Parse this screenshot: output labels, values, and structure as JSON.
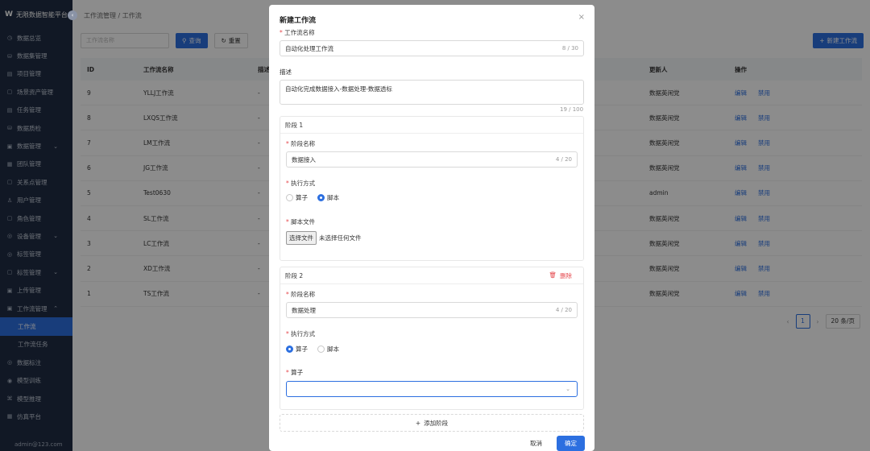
{
  "brand": {
    "logo": "W",
    "title": "无限数据智能平台"
  },
  "sidebar": {
    "items": [
      {
        "icon": "◷",
        "label": "数据总览"
      },
      {
        "icon": "⛁",
        "label": "数据集管理"
      },
      {
        "icon": "▤",
        "label": "项目管理"
      },
      {
        "icon": "▢",
        "label": "场景资产管理"
      },
      {
        "icon": "▤",
        "label": "任务管理"
      },
      {
        "icon": "⛁",
        "label": "数据质检"
      },
      {
        "icon": "▣",
        "label": "数据管理",
        "arrow": "⌄"
      },
      {
        "icon": "▦",
        "label": "团队管理"
      },
      {
        "icon": "▢",
        "label": "关系点管理"
      },
      {
        "icon": "♙",
        "label": "用户管理"
      },
      {
        "icon": "▢",
        "label": "角色管理"
      },
      {
        "icon": "◎",
        "label": "设备管理",
        "arrow": "⌄"
      },
      {
        "icon": "◎",
        "label": "标签管理"
      },
      {
        "icon": "▢",
        "label": "标签管理",
        "arrow": "⌄"
      },
      {
        "icon": "▣",
        "label": "上传管理"
      },
      {
        "icon": "▣",
        "label": "工作流管理",
        "arrow": "⌃"
      },
      {
        "icon": "",
        "label": "工作流",
        "sub": true,
        "active": true
      },
      {
        "icon": "",
        "label": "工作流任务",
        "sub": true
      },
      {
        "icon": "◎",
        "label": "数据标注"
      },
      {
        "icon": "◉",
        "label": "模型训练"
      },
      {
        "icon": "⌘",
        "label": "模型推理"
      },
      {
        "icon": "▦",
        "label": "仿真平台"
      }
    ],
    "user": "admin@123.com",
    "collapse_icon": "‹"
  },
  "header": {
    "breadcrumb": "工作流管理 / 工作流"
  },
  "search": {
    "placeholder": "工作流名称",
    "query_label": "查询",
    "reset_label": "重置",
    "query_icon": "⚲",
    "reset_icon": "↻"
  },
  "new_button": {
    "label": "新建工作流",
    "icon": "+"
  },
  "table": {
    "columns": [
      "ID",
      "工作流名称",
      "描述",
      "更新人",
      "操作"
    ],
    "rows": [
      {
        "id": "9",
        "name": "YLLJ工作流",
        "desc": "-",
        "updater": "数据英闲党",
        "edit": "编辑",
        "disable": "禁用"
      },
      {
        "id": "8",
        "name": "LXQS工作流",
        "desc": "-",
        "updater": "数据英闲党",
        "edit": "编辑",
        "disable": "禁用"
      },
      {
        "id": "7",
        "name": "LM工作流",
        "desc": "-",
        "updater": "数据英闲党",
        "edit": "编辑",
        "disable": "禁用"
      },
      {
        "id": "6",
        "name": "JG工作流",
        "desc": "-",
        "updater": "数据英闲党",
        "edit": "编辑",
        "disable": "禁用"
      },
      {
        "id": "5",
        "name": "Test0630",
        "desc": "-",
        "updater": "admin",
        "edit": "编辑",
        "disable": "禁用"
      },
      {
        "id": "4",
        "name": "SL工作流",
        "desc": "-",
        "updater": "数据英闲党",
        "edit": "编辑",
        "disable": "禁用"
      },
      {
        "id": "3",
        "name": "LC工作流",
        "desc": "-",
        "updater": "数据英闲党",
        "edit": "编辑",
        "disable": "禁用"
      },
      {
        "id": "2",
        "name": "XD工作流",
        "desc": "-",
        "updater": "数据英闲党",
        "edit": "编辑",
        "disable": "禁用"
      },
      {
        "id": "1",
        "name": "TS工作流",
        "desc": "-",
        "updater": "数据英闲党",
        "edit": "编辑",
        "disable": "禁用"
      }
    ]
  },
  "pagination": {
    "prev": "‹",
    "page": "1",
    "next": "›",
    "page_size": "20 条/页"
  },
  "modal": {
    "title": "新建工作流",
    "close_icon": "×",
    "name_label": "工作流名称",
    "name_value": "自动化处理工作流",
    "name_count": "8 / 30",
    "desc_label": "描述",
    "desc_value": "自动化完成数据接入-数据处理-数据透标",
    "desc_count": "19 / 100",
    "stage1": {
      "title": "阶段 1",
      "name_label": "阶段名称",
      "name_value": "数据接入",
      "name_count": "4 / 20",
      "exec_label": "执行方式",
      "opt_operator": "算子",
      "opt_script": "脚本",
      "selected": "脚本",
      "file_label": "脚本文件",
      "file_button": "选择文件",
      "file_status": "未选择任何文件"
    },
    "stage2": {
      "title": "阶段 2",
      "delete_label": "删除",
      "delete_icon": "🗑",
      "name_label": "阶段名称",
      "name_value": "数据处理",
      "name_count": "4 / 20",
      "exec_label": "执行方式",
      "opt_operator": "算子",
      "opt_script": "脚本",
      "selected": "算子",
      "operator_label": "算子",
      "operator_value": "",
      "chevron": "⌄"
    },
    "add_stage": {
      "icon": "+",
      "label": "添加阶段"
    },
    "cancel_label": "取消",
    "ok_label": "确定"
  }
}
